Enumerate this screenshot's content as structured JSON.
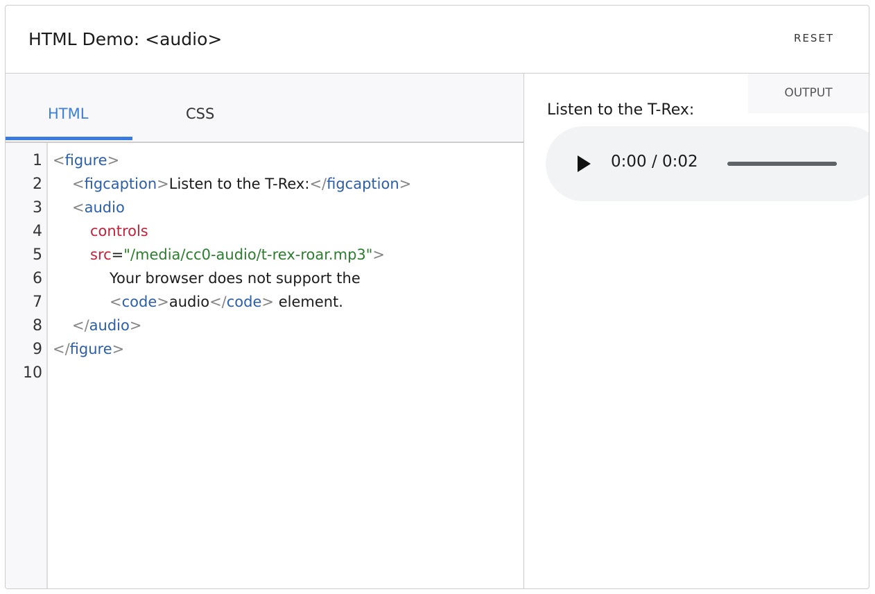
{
  "header": {
    "title": "HTML Demo: <audio>",
    "reset_label": "RESET"
  },
  "editor": {
    "tabs": [
      {
        "label": "HTML",
        "active": true
      },
      {
        "label": "CSS",
        "active": false
      }
    ],
    "line_numbers": [
      "1",
      "2",
      "3",
      "4",
      "5",
      "6",
      "7",
      "8",
      "9",
      "10"
    ],
    "code": {
      "l1": {
        "p1": "<",
        "tag": "figure",
        "p2": ">"
      },
      "l2": {
        "p1": "<",
        "tag": "figcaption",
        "p2": ">",
        "text": "Listen to the T-Rex:",
        "p3": "</",
        "tag2": "figcaption",
        "p4": ">"
      },
      "l3": {
        "p1": "<",
        "tag": "audio"
      },
      "l4": {
        "attr": "controls"
      },
      "l5": {
        "attr": "src",
        "eq": "=",
        "str": "\"/media/cc0-audio/t-rex-roar.mp3\"",
        "p1": ">"
      },
      "l6": {
        "text": "Your browser does not support the"
      },
      "l7": {
        "p1": "<",
        "tag": "code",
        "p2": ">",
        "text": "audio",
        "p3": "</",
        "tag2": "code",
        "p4": ">",
        "text2": " element."
      },
      "l8": {
        "p1": "</",
        "tag": "audio",
        "p2": ">"
      },
      "l9": {
        "p1": "</",
        "tag": "figure",
        "p2": ">"
      }
    }
  },
  "output": {
    "label": "OUTPUT",
    "figcaption": "Listen to the T-Rex:",
    "player": {
      "time": "0:00 / 0:02",
      "progress": 0
    }
  },
  "colors": {
    "accent": "#3a7be0",
    "tag": "#2c5fa8",
    "attribute": "#c3223b",
    "string": "#2d7d2f",
    "punctuation": "#858585"
  }
}
